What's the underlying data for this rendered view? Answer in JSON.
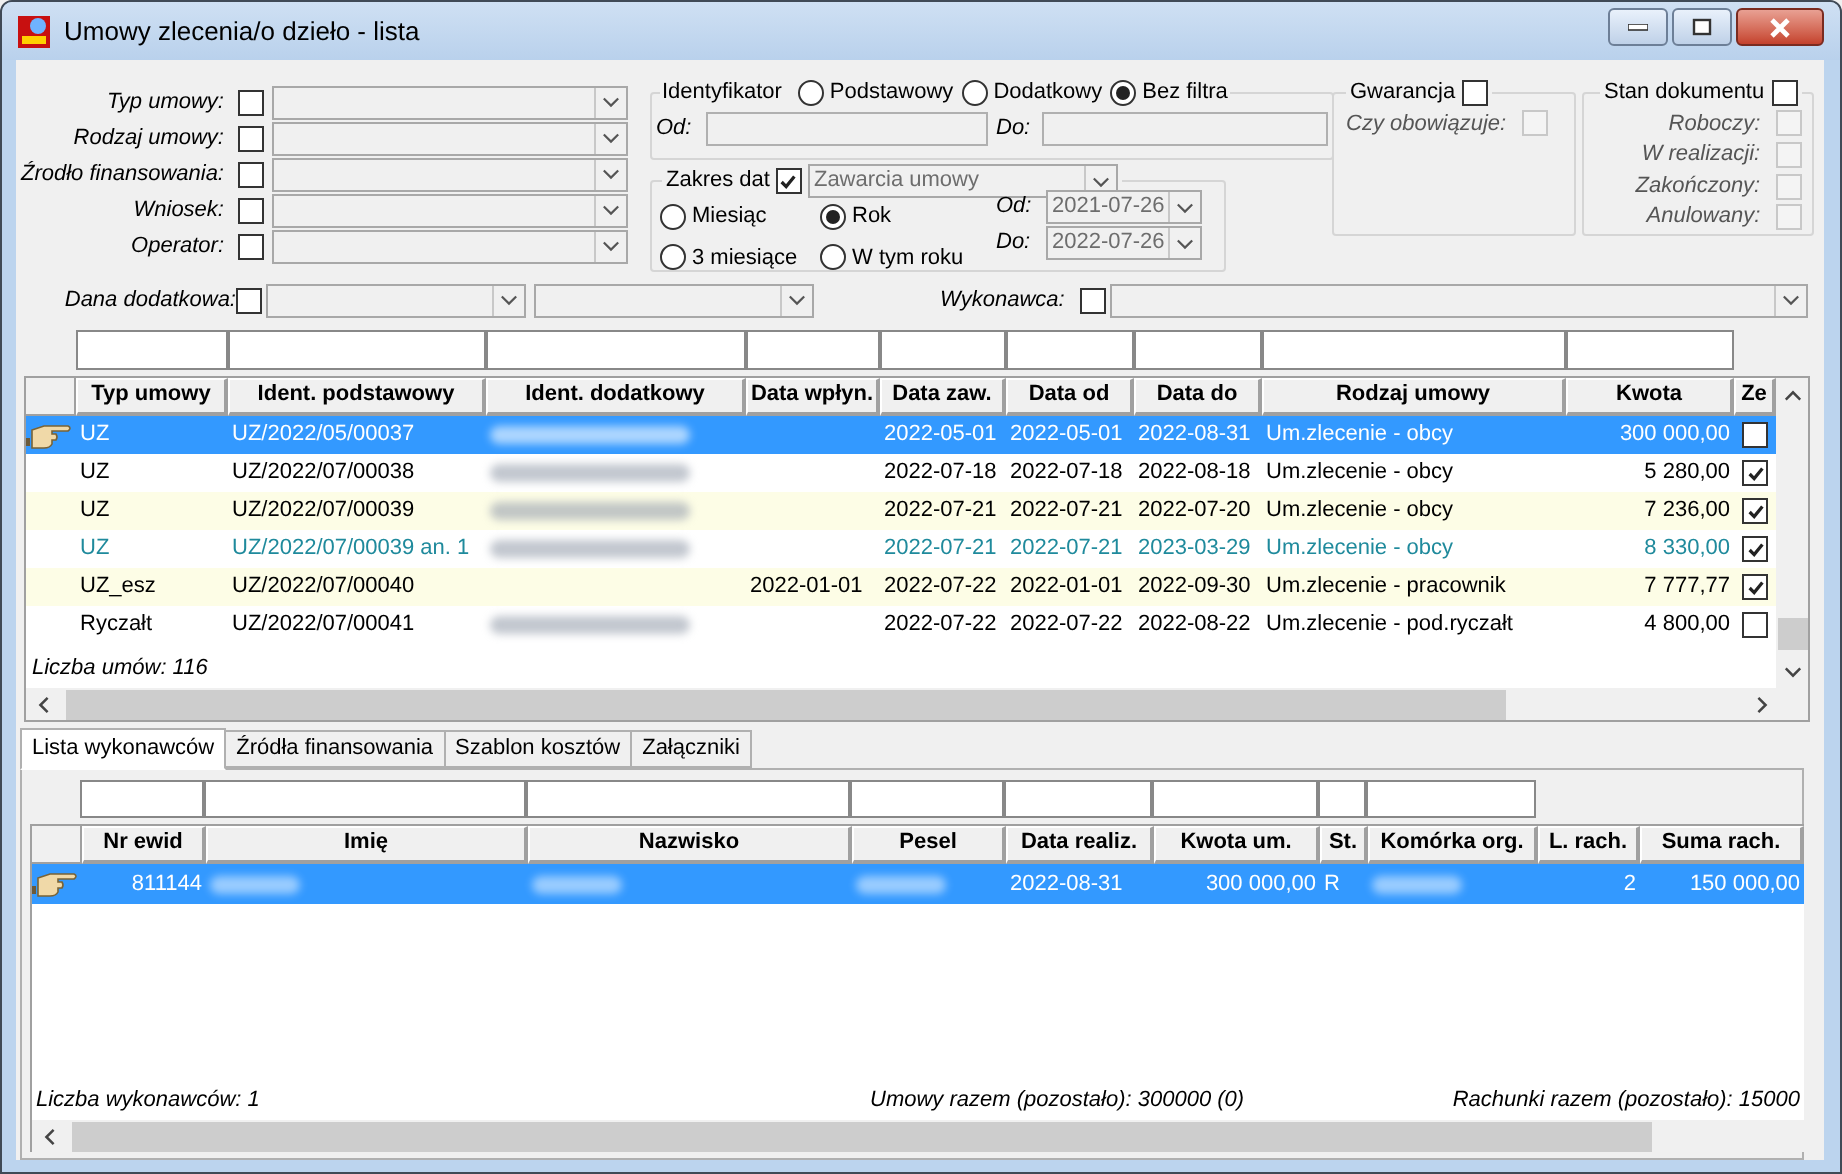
{
  "window": {
    "title": "Umowy zlecenia/o dzieło - lista"
  },
  "filters": [
    {
      "label": "Typ umowy:",
      "checked": false
    },
    {
      "label": "Rodzaj umowy:",
      "checked": false
    },
    {
      "label": "Źrodło finansowania:",
      "checked": false
    },
    {
      "label": "Wniosek:",
      "checked": false
    },
    {
      "label": "Operator:",
      "checked": false
    }
  ],
  "identyfikator": {
    "label": "Identyfikator",
    "options": [
      {
        "label": "Podstawowy",
        "selected": false
      },
      {
        "label": "Dodatkowy",
        "selected": false
      },
      {
        "label": "Bez filtra",
        "selected": true
      }
    ],
    "od_label": "Od:",
    "do_label": "Do:"
  },
  "zakres_dat": {
    "label": "Zakres dat",
    "checked": true,
    "combo_value": "Zawarcia umowy",
    "periods": [
      {
        "label": "Miesiąc",
        "selected": false
      },
      {
        "label": "Rok",
        "selected": true
      },
      {
        "label": "3 miesiące",
        "selected": false
      },
      {
        "label": "W tym roku",
        "selected": false
      }
    ],
    "od_label": "Od:",
    "od_value": "2021-07-26",
    "do_label": "Do:",
    "do_value": "2022-07-26"
  },
  "gwarancja": {
    "label": "Gwarancja",
    "checked": false,
    "items": [
      {
        "label": "Czy obowiązuje:",
        "checked": false,
        "disabled": true
      }
    ]
  },
  "stan_dokumentu": {
    "label": "Stan dokumentu",
    "checked": false,
    "items": [
      {
        "label": "Roboczy:",
        "checked": false,
        "disabled": true
      },
      {
        "label": "W realizacji:",
        "checked": false,
        "disabled": true
      },
      {
        "label": "Zakończony:",
        "checked": false,
        "disabled": true
      },
      {
        "label": "Anulowany:",
        "checked": false,
        "disabled": true
      }
    ]
  },
  "dana_dodatkowa": {
    "label": "Dana dodatkowa:",
    "checked": false
  },
  "wykonawca": {
    "label": "Wykonawca:",
    "checked": false
  },
  "contracts": {
    "columns": [
      {
        "title": "Typ umowy",
        "filter_box": true
      },
      {
        "title": "Ident. podstawowy",
        "filter_box": true
      },
      {
        "title": "Ident. dodatkowy",
        "filter_box": true
      },
      {
        "title": "Data wpłyn.",
        "filter_box": true
      },
      {
        "title": "Data zaw.",
        "filter_box": true
      },
      {
        "title": "Data od",
        "filter_box": true
      },
      {
        "title": "Data do",
        "filter_box": true
      },
      {
        "title": "Rodzaj umowy",
        "filter_box": true
      },
      {
        "title": "Kwota",
        "filter_box": true
      },
      {
        "title": "Ze",
        "filter_box": false
      }
    ],
    "rows": [
      {
        "typ": "UZ",
        "ident_podstawowy": "UZ/2022/05/00037",
        "ident_dodatkowy_blurred": true,
        "data_zaw": "2022-05-01",
        "data_od": "2022-05-01",
        "data_do": "2022-08-31",
        "rodzaj": "Um.zlecenie - obcy",
        "kwota": "300 000,00",
        "zes_checked": false,
        "selected": true
      },
      {
        "typ": "UZ",
        "ident_podstawowy": "UZ/2022/07/00038",
        "ident_dodatkowy_blurred": true,
        "data_zaw": "2022-07-18",
        "data_od": "2022-07-18",
        "data_do": "2022-08-18",
        "rodzaj": "Um.zlecenie - obcy",
        "kwota": "5 280,00",
        "zes_checked": true,
        "selected": false,
        "shaded": false,
        "color": "#000000"
      },
      {
        "typ": "UZ",
        "ident_podstawowy": "UZ/2022/07/00039",
        "ident_dodatkowy_blurred": true,
        "data_zaw": "2022-07-21",
        "data_od": "2022-07-21",
        "data_do": "2022-07-20",
        "rodzaj": "Um.zlecenie - obcy",
        "kwota": "7 236,00",
        "zes_checked": true,
        "selected": false,
        "shaded": true,
        "color": "#000000"
      },
      {
        "typ": "UZ",
        "ident_podstawowy": "UZ/2022/07/00039 an. 1",
        "ident_dodatkowy_blurred": true,
        "data_zaw": "2022-07-21",
        "data_od": "2022-07-21",
        "data_do": "2023-03-29",
        "rodzaj": "Um.zlecenie - obcy",
        "kwota": "8 330,00",
        "zes_checked": true,
        "selected": false,
        "shaded": false,
        "color": "#1f8a9c"
      },
      {
        "typ": "UZ_esz",
        "ident_podstawowy": "UZ/2022/07/00040",
        "ident_dodatkowy_blurred": false,
        "data_wplyn": "2022-01-01",
        "data_zaw": "2022-07-22",
        "data_od": "2022-01-01",
        "data_do": "2022-09-30",
        "rodzaj": "Um.zlecenie - pracownik",
        "kwota": "7 777,77",
        "zes_checked": true,
        "selected": false,
        "shaded": true,
        "color": "#000000"
      },
      {
        "typ": "Ryczałt",
        "ident_podstawowy": "UZ/2022/07/00041",
        "ident_dodatkowy_blurred": true,
        "data_zaw": "2022-07-22",
        "data_od": "2022-07-22",
        "data_do": "2022-08-22",
        "rodzaj": "Um.zlecenie - pod.ryczałt",
        "kwota": "4 800,00",
        "zes_checked": false,
        "selected": false,
        "shaded": false,
        "color": "#000000"
      }
    ],
    "footer": "Liczba umów: 116"
  },
  "tabs": [
    {
      "label": "Lista wykonawców",
      "selected": true
    },
    {
      "label": "Źródła finansowania",
      "selected": false
    },
    {
      "label": "Szablon kosztów",
      "selected": false
    },
    {
      "label": "Załączniki",
      "selected": false
    }
  ],
  "contractors": {
    "columns": [
      {
        "title": "Nr ewid",
        "filter_box": true
      },
      {
        "title": "Imię",
        "filter_box": true
      },
      {
        "title": "Nazwisko",
        "filter_box": true
      },
      {
        "title": "Pesel",
        "filter_box": true
      },
      {
        "title": "Data realiz.",
        "filter_box": true
      },
      {
        "title": "Kwota um.",
        "filter_box": true
      },
      {
        "title": "St.",
        "filter_box": true
      },
      {
        "title": "Komórka org.",
        "filter_box": true
      },
      {
        "title": "L. rach.",
        "filter_box": false
      },
      {
        "title": "Suma rach.",
        "filter_box": false
      }
    ],
    "rows": [
      {
        "nr_ewid": "811144",
        "personal_blurred": true,
        "data_realiz": "2022-08-31",
        "kwota_um": "300 000,00",
        "st": "R",
        "l_rach": "2",
        "suma_rach": "150 000,00",
        "selected": true
      }
    ],
    "footer": [
      "Liczba wykonawców: 1",
      "Umowy razem (pozostało): 300000 (0)",
      "Rachunki razem (pozostało): 15000"
    ]
  }
}
